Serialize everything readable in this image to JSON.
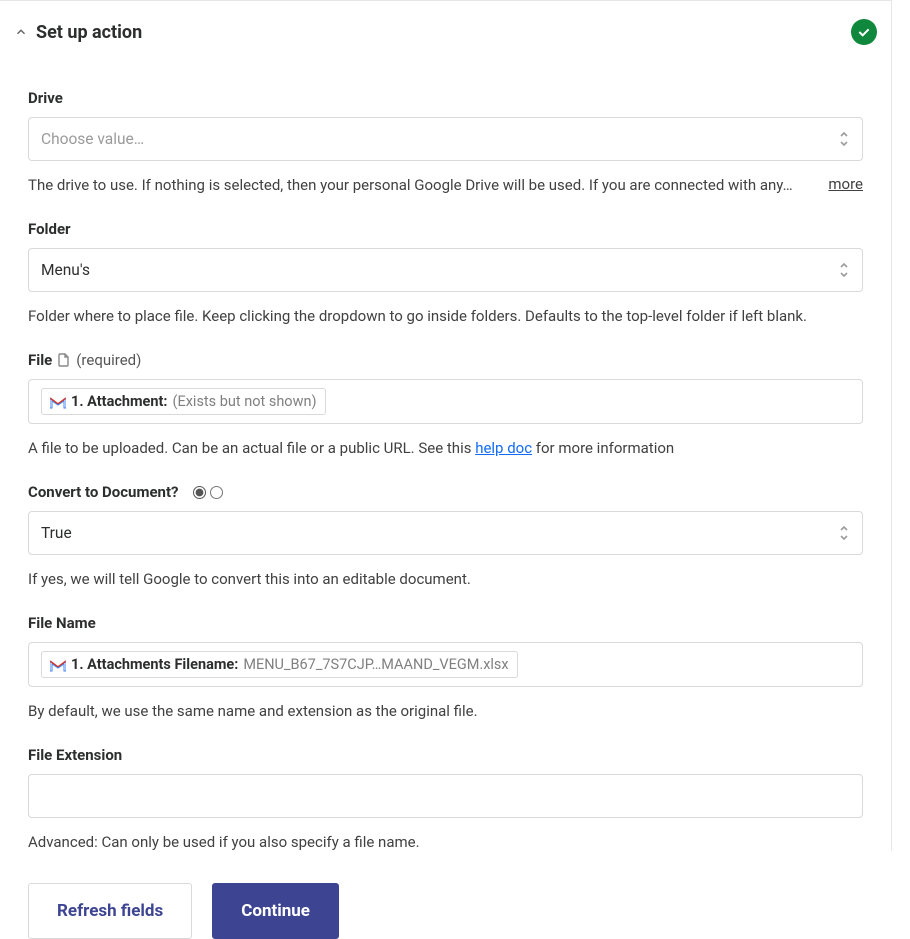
{
  "header": {
    "title": "Set up action"
  },
  "fields": {
    "drive": {
      "label": "Drive",
      "placeholder": "Choose value…",
      "helper": "The drive to use. If nothing is selected, then your personal Google Drive will be used. If you are connected with any…",
      "more": "more"
    },
    "folder": {
      "label": "Folder",
      "value": "Menu's",
      "helper": "Folder where to place file. Keep clicking the dropdown to go inside folders. Defaults to the top-level folder if left blank."
    },
    "file": {
      "label": "File",
      "required": "(required)",
      "pill_prefix": "1. Attachment:",
      "pill_value": "(Exists but not shown)",
      "helper_pre": "A file to be uploaded. Can be an actual file or a public URL. See this ",
      "helper_link": "help doc",
      "helper_post": " for more information"
    },
    "convert": {
      "label": "Convert to Document?",
      "value": "True",
      "helper": "If yes, we will tell Google to convert this into an editable document."
    },
    "filename": {
      "label": "File Name",
      "pill_prefix": "1. Attachments Filename:",
      "pill_value": "MENU_B67_7S7CJP…MAAND_VEGM.xlsx",
      "helper": "By default, we use the same name and extension as the original file."
    },
    "ext": {
      "label": "File Extension",
      "helper": "Advanced: Can only be used if you also specify a file name."
    }
  },
  "buttons": {
    "refresh": "Refresh fields",
    "continue": "Continue"
  }
}
